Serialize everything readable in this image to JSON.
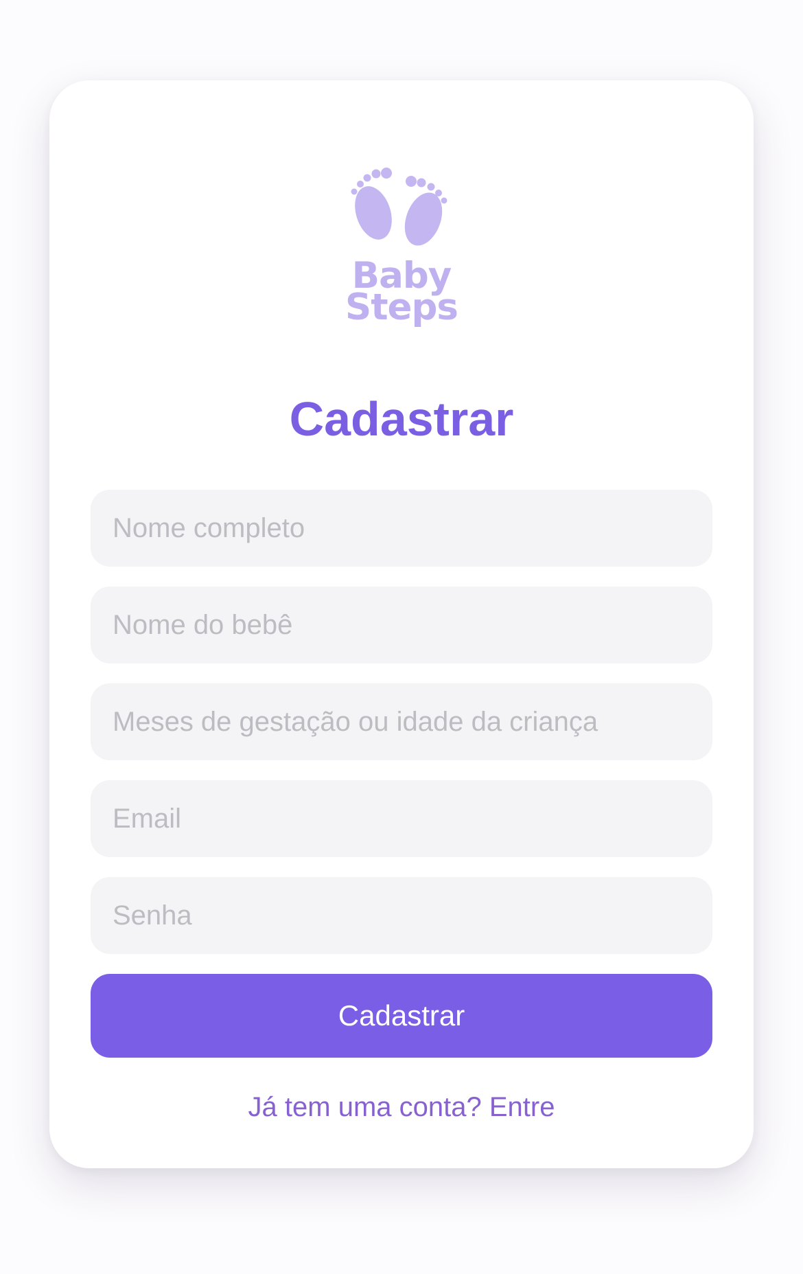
{
  "logo": {
    "icon": "baby-footprints-icon",
    "line1": "Baby",
    "line2": "Steps",
    "color": "#bfb0ef"
  },
  "title": "Cadastrar",
  "form": {
    "full_name_placeholder": "Nome completo",
    "baby_name_placeholder": "Nome do bebê",
    "age_placeholder": "Meses de gestação ou idade da criança",
    "email_placeholder": "Email",
    "password_placeholder": "Senha",
    "submit_label": "Cadastrar"
  },
  "login_link": "Já tem uma conta? Entre",
  "colors": {
    "accent": "#7a5fe6",
    "title": "#7a5fe3",
    "link": "#8661cf",
    "input_bg": "#f4f3f6",
    "placeholder": "#bdbcc2"
  }
}
